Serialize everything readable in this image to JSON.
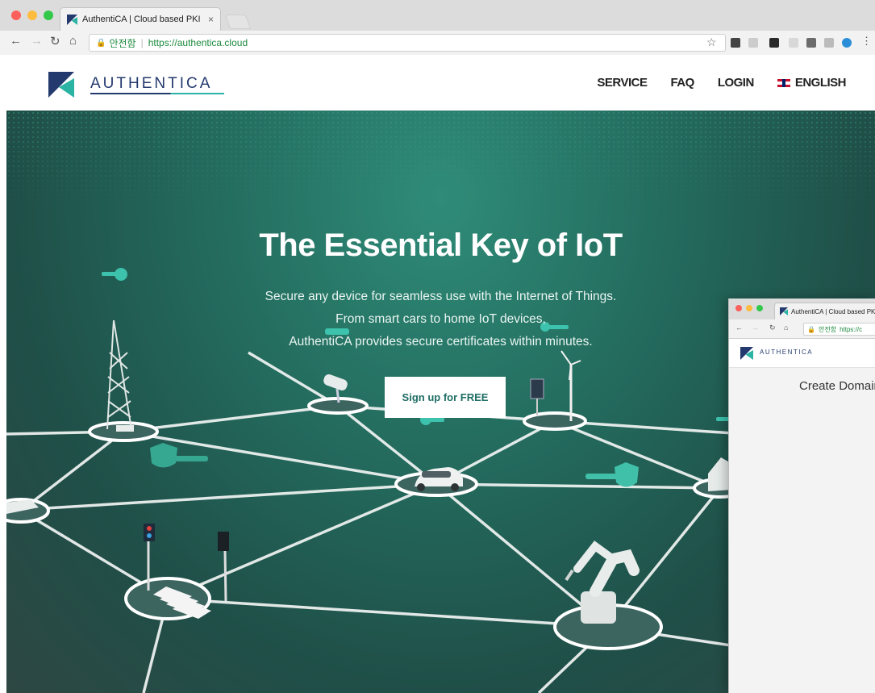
{
  "browser": {
    "tab_title": "AuthentiCA | Cloud based PKI",
    "tab_close": "×",
    "secure_label": "안전함",
    "url": "https://authentica.cloud"
  },
  "site": {
    "logo_text": "AUTHENTICA",
    "nav": [
      "SERVICE",
      "FAQ",
      "LOGIN",
      "ENGLISH"
    ]
  },
  "hero": {
    "title": "The Essential Key of IoT",
    "lines": [
      "Secure any device for seamless use with the Internet of Things.",
      "From smart cars to home IoT devices,",
      "AuthentiCA provides secure certificates within minutes."
    ],
    "cta_label": "Sign up for FREE"
  },
  "overlay": {
    "tab_title": "AuthentiCA | Cloud based PKI",
    "secure_label": "안전함",
    "url": "https://c",
    "logo_text": "AUTHENTICA",
    "heading": "Create Domain"
  },
  "colors": {
    "brand_navy": "#243a6e",
    "brand_teal": "#2bb3a3",
    "hero_green": "#246d5f",
    "secure_green": "#1d8a3e"
  }
}
